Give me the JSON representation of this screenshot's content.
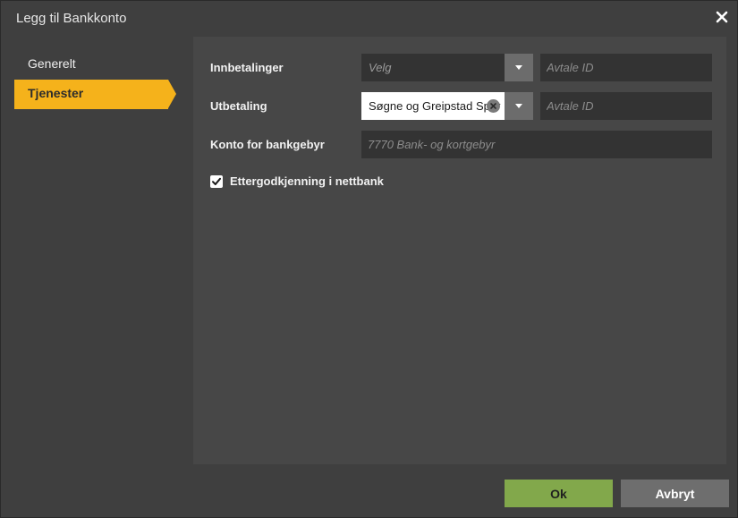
{
  "dialog": {
    "title": "Legg til Bankkonto",
    "close_icon": "close-icon"
  },
  "sidebar": {
    "items": [
      {
        "label": "Generelt",
        "active": false
      },
      {
        "label": "Tjenester",
        "active": true
      }
    ]
  },
  "form": {
    "innbetalinger": {
      "label": "Innbetalinger",
      "select_placeholder": "Velg",
      "agreement_placeholder": "Avtale ID"
    },
    "utbetaling": {
      "label": "Utbetaling",
      "select_value": "Søgne og Greipstad Sparebank",
      "agreement_placeholder": "Avtale ID"
    },
    "bank_fee_account": {
      "label": "Konto for bankgebyr",
      "placeholder": "7770 Bank- og kortgebyr"
    },
    "netbank_approval": {
      "label": "Ettergodkjenning i nettbank",
      "checked": true
    }
  },
  "buttons": {
    "ok": "Ok",
    "cancel": "Avbryt"
  },
  "colors": {
    "accent": "#f5b21b",
    "ok_button": "#82a84b",
    "cancel_button": "#6e6e6e",
    "panel": "#474747",
    "background": "#3f3f3f"
  }
}
